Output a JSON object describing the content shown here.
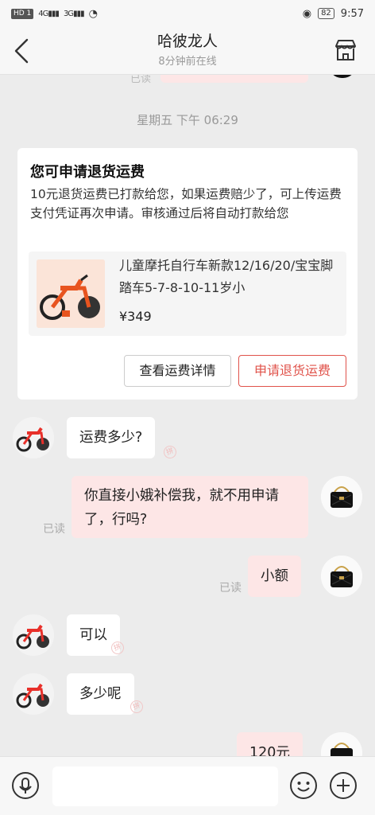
{
  "status_bar": {
    "hd": "HD 1",
    "signal1": "4G",
    "signal2": "3G",
    "battery": "82",
    "time": "9:57"
  },
  "header": {
    "title": "哈彼龙人",
    "subtitle": "8分钟前在线"
  },
  "top_cut": {
    "read": "已读"
  },
  "timestamp": "星期五 下午 06:29",
  "refund_card": {
    "title": "您可申请退货运费",
    "body": "10元退货运费已打款给您，如果运费赔少了，可上传运费支付凭证再次申请。审核通过后将自动打款给您",
    "product_name": "儿童摩托自行车新款12/16/20/宝宝脚踏车5-7-8-10-11岁小",
    "price": "¥349",
    "btn_details": "查看运费详情",
    "btn_apply": "申请退货运费"
  },
  "messages": [
    {
      "side": "in",
      "text": "运费多少?"
    },
    {
      "side": "out",
      "text": "你直接小娥补偿我，就不用申请了，行吗?",
      "read": "已读"
    },
    {
      "side": "out",
      "text": "小额",
      "read": "已读"
    },
    {
      "side": "in",
      "text": "可以"
    },
    {
      "side": "in",
      "text": "多少呢"
    },
    {
      "side": "out",
      "text": "120元"
    }
  ],
  "watermark": "拼",
  "colors": {
    "accent": "#e0524a",
    "out_bubble": "#fde6e6",
    "background": "#ececec"
  }
}
